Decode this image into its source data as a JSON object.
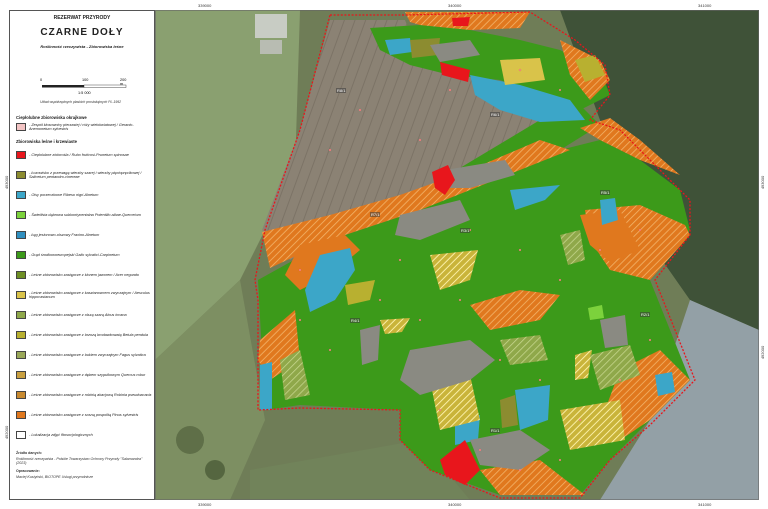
{
  "legend": {
    "heading": "REZERWAT PRZYRODY",
    "title": "CZARNE DOŁY",
    "subtitle": "Roślinność rzeczywista - Zbiorowiska leśne",
    "scale": {
      "ticks": [
        "0",
        "100",
        "200 m"
      ],
      "ratio": "1:5 000"
    },
    "crs_note": "Układ współrzędnych płaskich prostokątnych PL-1992",
    "section_nonforest": "Ciepłolubne zbiorowiska okrajkowe",
    "nonforest_items": [
      {
        "label": "- Zespół kłosownicy pierzastej i róży wielokwiatowej / Geranio-Anemonetum sylvestris",
        "color": "#f3c4c4"
      }
    ],
    "section_forest": "Zbiorowiska leśne i krzewiaste",
    "forest_items": [
      {
        "label": "- Ciepłolubne ziołorośla / Rubo fruticosi-Prunetum spinosae",
        "color": "#e8161c"
      },
      {
        "label": "- Łozowisko z przewagą wierzby szarej i wierzby pięciopręcikowej / Salicetum pentandro-cinereae",
        "color": "#8c8c30"
      },
      {
        "label": "- Olsy porzeczkowe Ribeso nigri-Alnetum",
        "color": "#3ca6c8"
      },
      {
        "label": "- Świetlista dąbrowa subkontynentalna Potentillo albae-Quercetum",
        "color": "#7cd23c"
      },
      {
        "label": "- Łęg jesionowo-olszowy Fraxino-Alnetum",
        "color": "#2f8fbf"
      },
      {
        "label": "- Grąd środkowoeuropejski Galio sylvatici-Carpinetum",
        "color": "#3c9a1a"
      },
      {
        "label": "- Leśne zbiorowisko zastępcze z klonem jaworem / Acer negundo",
        "color": "#6e8f24"
      },
      {
        "label": "- Leśne zbiorowisko zastępcze z kasztanowcem zwyczajnym / Aesculus hippocastanum",
        "color": "#d9c34a"
      },
      {
        "label": "- Leśne zbiorowisko zastępcze z olszą szarą Alnus incana",
        "color": "#8fa84a"
      },
      {
        "label": "- Leśne zbiorowisko zastępcze z brzozą brodawkowatą Betula pendula",
        "color": "#b8b030"
      },
      {
        "label": "- Leśne zbiorowisko zastępcze z bukiem zwyczajnym Fagus sylvatica",
        "color": "#9aa858"
      },
      {
        "label": "- Leśne zbiorowisko zastępcze z dębem szypułkowym Quercus robur",
        "color": "#c9a040"
      },
      {
        "label": "- Leśne zbiorowisko zastępcze z robinią akacjową Robinia pseudoacacia",
        "color": "#c88a30"
      },
      {
        "label": "- Leśne zbiorowisko zastępcze z sosną pospolitą Pinus sylvestris",
        "color": "#e0781e"
      },
      {
        "label": "- Lokalizacja zdjęć fitosocjologicznych",
        "color": "#ffffff"
      }
    ],
    "source_heading": "Źródło danych:",
    "source_text": "Roślinność rzeczywista - Polskie Towarzystwo Ochrony Przyrody \"Salamandra\" (2023)",
    "author_heading": "Opracowanie:",
    "author_text": "Maciej Kustyński, BIOTOPE Usługi przyrodnicze"
  },
  "grid": {
    "top": [
      "339000",
      "340000",
      "341000"
    ],
    "bottom": [
      "339000",
      "340000",
      "341000"
    ],
    "left": [
      "493000",
      "492000"
    ],
    "right": [
      "493000",
      "492000"
    ]
  },
  "map_labels": [
    "R8/1",
    "R7/1",
    "R6/1",
    "R5/1",
    "R4/1",
    "R3/1",
    "R2/1",
    "R1/1"
  ],
  "colors": {
    "grad": "#3c9a1a",
    "pine": "#e0781e",
    "alder": "#3ca6c8",
    "red": "#e8161c",
    "yellow": "#d9c34a",
    "olive": "#8c8c30",
    "gray": "#8a8a82",
    "boundary": "#e8161c"
  }
}
